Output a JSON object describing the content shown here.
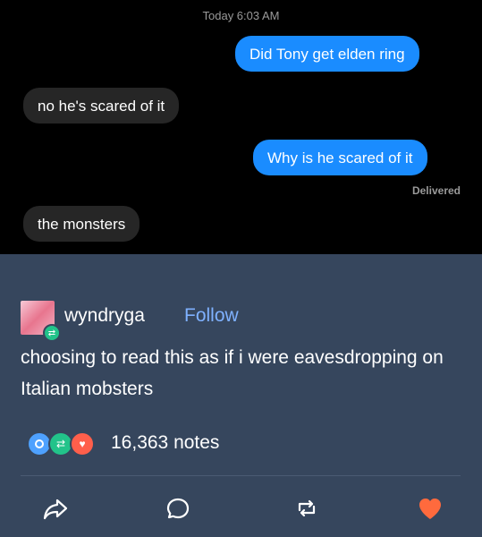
{
  "imessage": {
    "timestamp": "Today 6:03 AM",
    "messages": [
      {
        "direction": "outgoing",
        "text": "Did Tony get elden ring"
      },
      {
        "direction": "incoming",
        "text": "no he's scared of it"
      },
      {
        "direction": "outgoing",
        "text": "Why is he scared of it"
      },
      {
        "direction": "incoming",
        "text": "the monsters"
      }
    ],
    "status": "Delivered",
    "colors": {
      "outgoing": "#1a8cff",
      "incoming": "#262626",
      "background": "#000000"
    }
  },
  "post": {
    "username": "wyndryga",
    "follow_label": "Follow",
    "text": "choosing to read this as if i were eavesdropping on Italian mobsters",
    "notes": "16,363 notes",
    "note_icons": [
      "reply-icon",
      "reblog-icon",
      "like-icon"
    ],
    "actions": [
      "share-icon",
      "reply-icon",
      "reblog-icon",
      "like-icon"
    ],
    "colors": {
      "background": "#36465d",
      "follow": "#7fb1ff",
      "like": "#ff6a3d"
    }
  }
}
